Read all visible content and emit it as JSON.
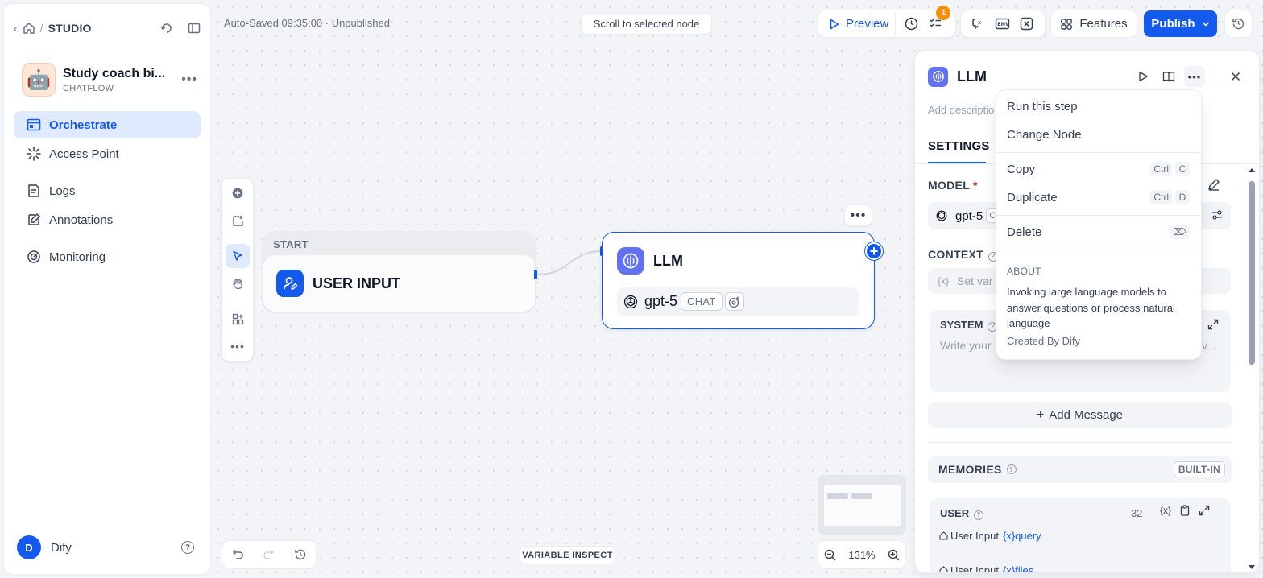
{
  "sidebar": {
    "studio_label": "STUDIO",
    "app": {
      "name": "Study coach bi...",
      "type": "CHATFLOW",
      "avatar": "🤖"
    },
    "nav": [
      {
        "label": "Orchestrate"
      },
      {
        "label": "Access Point"
      },
      {
        "label": "Logs"
      },
      {
        "label": "Annotations"
      },
      {
        "label": "Monitoring"
      }
    ],
    "user": {
      "initial": "D",
      "name": "Dify"
    }
  },
  "toolbar": {
    "autosave": "Auto-Saved 09:35:00 · Unpublished",
    "scroll_to_node": "Scroll to selected node",
    "preview": "Preview",
    "checklist_badge": "1",
    "features": "Features",
    "publish": "Publish"
  },
  "nodes": {
    "start": {
      "header": "START",
      "title": "USER INPUT"
    },
    "llm": {
      "title": "LLM",
      "model": "gpt-5",
      "mode": "CHAT"
    }
  },
  "bottom": {
    "variable_inspect": "VARIABLE INSPECT",
    "zoom": "131%"
  },
  "panel": {
    "title": "LLM",
    "description_placeholder": "Add descriptio",
    "tab": "SETTINGS",
    "model_label": "MODEL",
    "model_required": "*",
    "model_name": "gpt-5",
    "model_chip": "C",
    "context_label": "CONTEXT",
    "context_placeholder": "Set var",
    "system_label": "SYSTEM",
    "system_placeholder": "Write your",
    "system_tail": "v...",
    "add_message": "Add Message",
    "memories_label": "MEMORIES",
    "memories_badge": "BUILT-IN",
    "user_label": "USER",
    "user_count": "32",
    "user_vars": [
      {
        "source": "User Input",
        "var": "{x}query"
      },
      {
        "source": "User Input",
        "var": "{x}files"
      }
    ]
  },
  "menu": {
    "run": "Run this step",
    "change": "Change Node",
    "copy": {
      "label": "Copy",
      "keys": [
        "Ctrl",
        "C"
      ]
    },
    "duplicate": {
      "label": "Duplicate",
      "keys": [
        "Ctrl",
        "D"
      ]
    },
    "delete": {
      "label": "Delete",
      "key": "⌦"
    },
    "about_label": "ABOUT",
    "about_text": "Invoking large language models to answer questions or process natural language",
    "created_by": "Created By Dify"
  }
}
